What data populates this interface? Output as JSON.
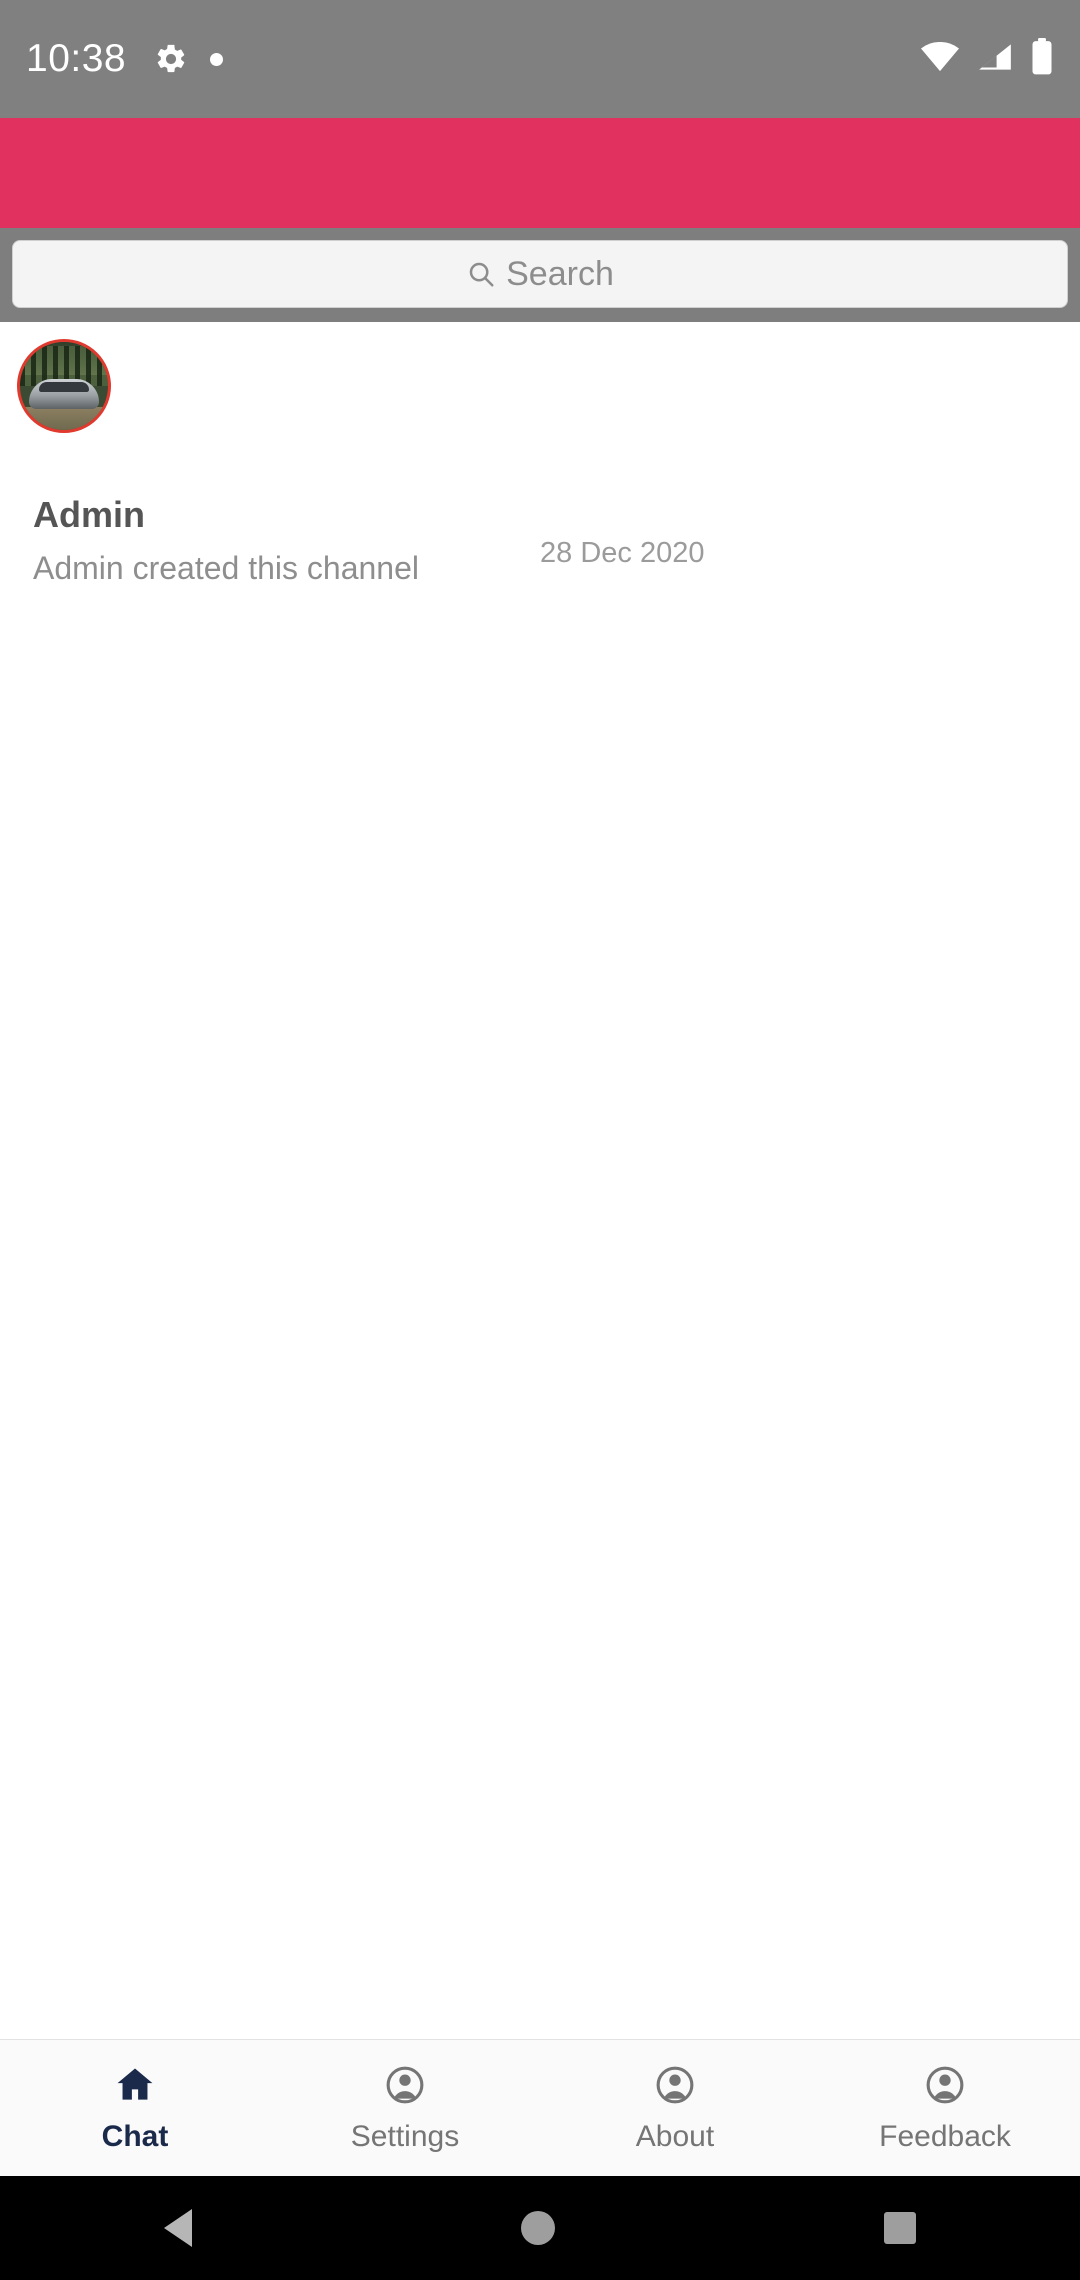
{
  "status_bar": {
    "clock": "10:38",
    "icons": [
      "gear-icon",
      "dot-icon",
      "wifi-icon",
      "signal-icon",
      "battery-icon"
    ]
  },
  "app_bar": {
    "color": "#e0315f"
  },
  "search": {
    "placeholder": "Search",
    "value": "",
    "icon": "search-icon"
  },
  "chat_list": [
    {
      "avatar_alt": "channel-avatar",
      "title": "Admin",
      "subtitle": "Admin created this channel",
      "date": "28 Dec 2020"
    }
  ],
  "bottom_nav": {
    "active_index": 0,
    "items": [
      {
        "label": "Chat",
        "icon": "home-icon"
      },
      {
        "label": "Settings",
        "icon": "person-icon"
      },
      {
        "label": "About",
        "icon": "person-icon"
      },
      {
        "label": "Feedback",
        "icon": "person-icon"
      }
    ]
  },
  "system_nav": {
    "back": "back-triangle-icon",
    "home": "home-circle-icon",
    "recents": "recents-square-icon"
  }
}
